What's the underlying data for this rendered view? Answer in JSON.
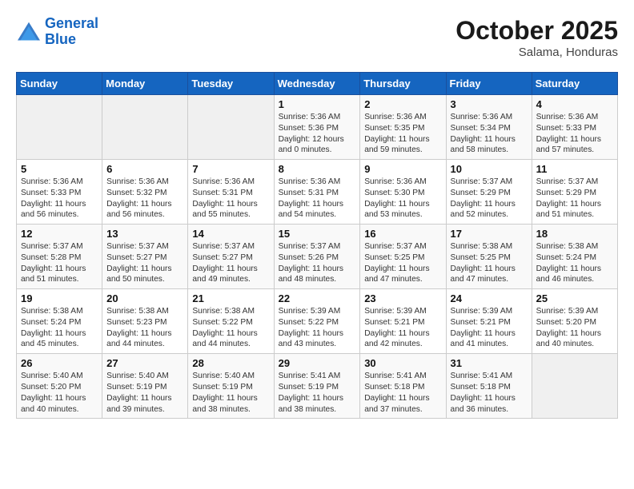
{
  "header": {
    "logo_line1": "General",
    "logo_line2": "Blue",
    "month": "October 2025",
    "location": "Salama, Honduras"
  },
  "weekdays": [
    "Sunday",
    "Monday",
    "Tuesday",
    "Wednesday",
    "Thursday",
    "Friday",
    "Saturday"
  ],
  "weeks": [
    [
      {
        "day": "",
        "info": ""
      },
      {
        "day": "",
        "info": ""
      },
      {
        "day": "",
        "info": ""
      },
      {
        "day": "1",
        "info": "Sunrise: 5:36 AM\nSunset: 5:36 PM\nDaylight: 12 hours\nand 0 minutes."
      },
      {
        "day": "2",
        "info": "Sunrise: 5:36 AM\nSunset: 5:35 PM\nDaylight: 11 hours\nand 59 minutes."
      },
      {
        "day": "3",
        "info": "Sunrise: 5:36 AM\nSunset: 5:34 PM\nDaylight: 11 hours\nand 58 minutes."
      },
      {
        "day": "4",
        "info": "Sunrise: 5:36 AM\nSunset: 5:33 PM\nDaylight: 11 hours\nand 57 minutes."
      }
    ],
    [
      {
        "day": "5",
        "info": "Sunrise: 5:36 AM\nSunset: 5:33 PM\nDaylight: 11 hours\nand 56 minutes."
      },
      {
        "day": "6",
        "info": "Sunrise: 5:36 AM\nSunset: 5:32 PM\nDaylight: 11 hours\nand 56 minutes."
      },
      {
        "day": "7",
        "info": "Sunrise: 5:36 AM\nSunset: 5:31 PM\nDaylight: 11 hours\nand 55 minutes."
      },
      {
        "day": "8",
        "info": "Sunrise: 5:36 AM\nSunset: 5:31 PM\nDaylight: 11 hours\nand 54 minutes."
      },
      {
        "day": "9",
        "info": "Sunrise: 5:36 AM\nSunset: 5:30 PM\nDaylight: 11 hours\nand 53 minutes."
      },
      {
        "day": "10",
        "info": "Sunrise: 5:37 AM\nSunset: 5:29 PM\nDaylight: 11 hours\nand 52 minutes."
      },
      {
        "day": "11",
        "info": "Sunrise: 5:37 AM\nSunset: 5:29 PM\nDaylight: 11 hours\nand 51 minutes."
      }
    ],
    [
      {
        "day": "12",
        "info": "Sunrise: 5:37 AM\nSunset: 5:28 PM\nDaylight: 11 hours\nand 51 minutes."
      },
      {
        "day": "13",
        "info": "Sunrise: 5:37 AM\nSunset: 5:27 PM\nDaylight: 11 hours\nand 50 minutes."
      },
      {
        "day": "14",
        "info": "Sunrise: 5:37 AM\nSunset: 5:27 PM\nDaylight: 11 hours\nand 49 minutes."
      },
      {
        "day": "15",
        "info": "Sunrise: 5:37 AM\nSunset: 5:26 PM\nDaylight: 11 hours\nand 48 minutes."
      },
      {
        "day": "16",
        "info": "Sunrise: 5:37 AM\nSunset: 5:25 PM\nDaylight: 11 hours\nand 47 minutes."
      },
      {
        "day": "17",
        "info": "Sunrise: 5:38 AM\nSunset: 5:25 PM\nDaylight: 11 hours\nand 47 minutes."
      },
      {
        "day": "18",
        "info": "Sunrise: 5:38 AM\nSunset: 5:24 PM\nDaylight: 11 hours\nand 46 minutes."
      }
    ],
    [
      {
        "day": "19",
        "info": "Sunrise: 5:38 AM\nSunset: 5:24 PM\nDaylight: 11 hours\nand 45 minutes."
      },
      {
        "day": "20",
        "info": "Sunrise: 5:38 AM\nSunset: 5:23 PM\nDaylight: 11 hours\nand 44 minutes."
      },
      {
        "day": "21",
        "info": "Sunrise: 5:38 AM\nSunset: 5:22 PM\nDaylight: 11 hours\nand 44 minutes."
      },
      {
        "day": "22",
        "info": "Sunrise: 5:39 AM\nSunset: 5:22 PM\nDaylight: 11 hours\nand 43 minutes."
      },
      {
        "day": "23",
        "info": "Sunrise: 5:39 AM\nSunset: 5:21 PM\nDaylight: 11 hours\nand 42 minutes."
      },
      {
        "day": "24",
        "info": "Sunrise: 5:39 AM\nSunset: 5:21 PM\nDaylight: 11 hours\nand 41 minutes."
      },
      {
        "day": "25",
        "info": "Sunrise: 5:39 AM\nSunset: 5:20 PM\nDaylight: 11 hours\nand 40 minutes."
      }
    ],
    [
      {
        "day": "26",
        "info": "Sunrise: 5:40 AM\nSunset: 5:20 PM\nDaylight: 11 hours\nand 40 minutes."
      },
      {
        "day": "27",
        "info": "Sunrise: 5:40 AM\nSunset: 5:19 PM\nDaylight: 11 hours\nand 39 minutes."
      },
      {
        "day": "28",
        "info": "Sunrise: 5:40 AM\nSunset: 5:19 PM\nDaylight: 11 hours\nand 38 minutes."
      },
      {
        "day": "29",
        "info": "Sunrise: 5:41 AM\nSunset: 5:19 PM\nDaylight: 11 hours\nand 38 minutes."
      },
      {
        "day": "30",
        "info": "Sunrise: 5:41 AM\nSunset: 5:18 PM\nDaylight: 11 hours\nand 37 minutes."
      },
      {
        "day": "31",
        "info": "Sunrise: 5:41 AM\nSunset: 5:18 PM\nDaylight: 11 hours\nand 36 minutes."
      },
      {
        "day": "",
        "info": ""
      }
    ]
  ]
}
